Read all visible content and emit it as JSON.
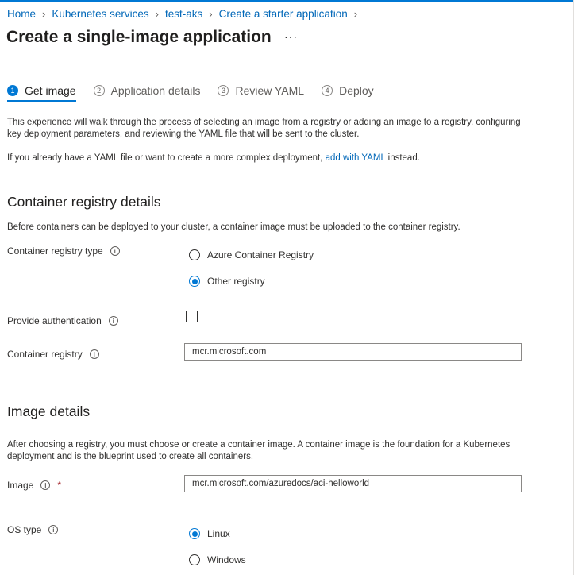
{
  "breadcrumb": [
    "Home",
    "Kubernetes services",
    "test-aks",
    "Create a starter application"
  ],
  "page_title": "Create a single-image application",
  "more_label": "···",
  "tabs": [
    {
      "num": "1",
      "label": "Get image"
    },
    {
      "num": "2",
      "label": "Application details"
    },
    {
      "num": "3",
      "label": "Review YAML"
    },
    {
      "num": "4",
      "label": "Deploy"
    }
  ],
  "intro": {
    "p1": "This experience will walk through the process of selecting an image from a registry or adding an image to a registry, configuring key deployment parameters, and reviewing the YAML file that will be sent to the cluster.",
    "p2_before": "If you already have a YAML file or want to create a more complex deployment, ",
    "p2_link": "add with YAML",
    "p2_after": " instead."
  },
  "registry_section": {
    "title": "Container registry details",
    "desc": "Before containers can be deployed to your cluster, a container image must be uploaded to the container registry.",
    "type_label": "Container registry type",
    "option_acr": "Azure Container Registry",
    "option_other": "Other registry",
    "auth_label": "Provide authentication",
    "registry_label": "Container registry",
    "registry_value": "mcr.microsoft.com"
  },
  "image_section": {
    "title": "Image details",
    "desc": "After choosing a registry, you must choose or create a container image. A container image is the foundation for a Kubernetes deployment and is the blueprint used to create all containers.",
    "image_label": "Image",
    "required_mark": "*",
    "image_value": "mcr.microsoft.com/azuredocs/aci-helloworld",
    "os_label": "OS type",
    "os_linux": "Linux",
    "os_windows": "Windows"
  },
  "info_glyph": "i",
  "selected": {
    "registry_type": "Other registry",
    "os_type": "Linux",
    "authentication": false
  }
}
